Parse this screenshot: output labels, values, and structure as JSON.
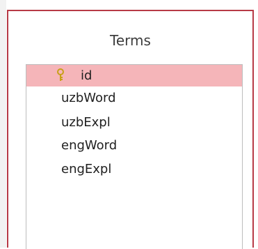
{
  "table": {
    "title": "Terms",
    "fields": [
      {
        "name": "id",
        "primary_key": true,
        "selected": true
      },
      {
        "name": "uzbWord",
        "primary_key": false,
        "selected": false
      },
      {
        "name": "uzbExpl",
        "primary_key": false,
        "selected": false
      },
      {
        "name": "engWord",
        "primary_key": false,
        "selected": false
      },
      {
        "name": "engExpl",
        "primary_key": false,
        "selected": false
      }
    ]
  },
  "colors": {
    "title_bar_accent": "#b73a46",
    "selected_row": "#f5b5b9",
    "key_icon": "#c8a018"
  },
  "icons": {
    "primary_key": "key-icon"
  }
}
